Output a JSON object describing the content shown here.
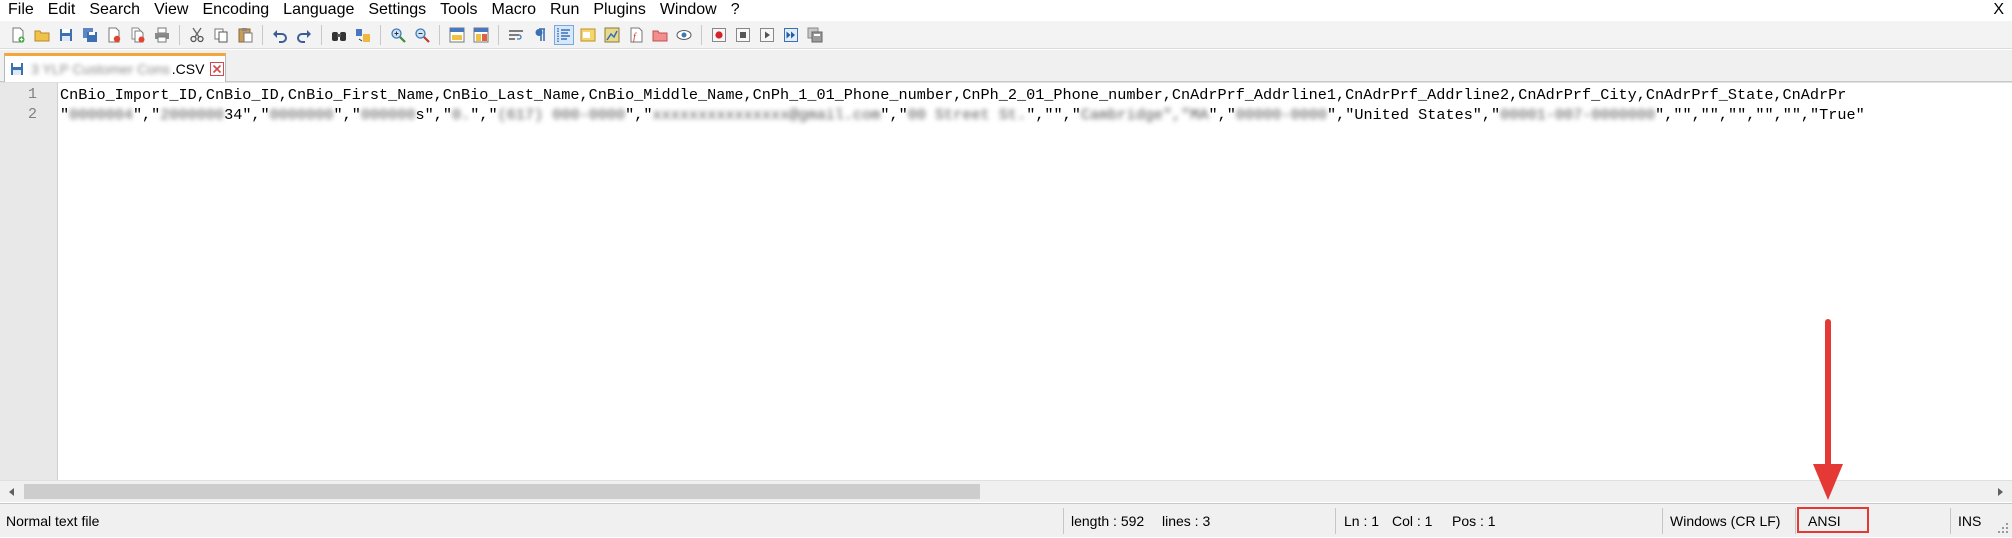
{
  "menu": {
    "items": [
      "File",
      "Edit",
      "Search",
      "View",
      "Encoding",
      "Language",
      "Settings",
      "Tools",
      "Macro",
      "Run",
      "Plugins",
      "Window",
      "?"
    ],
    "close": "X"
  },
  "toolbar": {
    "icons": [
      "new-file-icon",
      "open-file-icon",
      "save-icon",
      "save-all-icon",
      "close-icon",
      "close-all-icon",
      "print-icon",
      "cut-icon",
      "copy-icon",
      "paste-icon",
      "undo-icon",
      "redo-icon",
      "find-icon",
      "replace-icon",
      "zoom-in-icon",
      "zoom-out-icon",
      "sync-vertical-icon",
      "sync-horizontal-icon",
      "word-wrap-icon",
      "show-all-chars-icon",
      "indent-guide-icon",
      "user-defined-language-icon",
      "document-map-icon",
      "function-list-icon",
      "folder-workspace-icon",
      "monitoring-icon",
      "record-macro-icon",
      "stop-macro-icon",
      "play-macro-icon",
      "run-macro-multiple-icon",
      "save-macro-icon"
    ]
  },
  "tab": {
    "name": "3 YLP Customer Cons",
    "ext": ".CSV"
  },
  "editor": {
    "line_numbers": [
      "1",
      "2"
    ],
    "line1": "CnBio_Import_ID,CnBio_ID,CnBio_First_Name,CnBio_Last_Name,CnBio_Middle_Name,CnPh_1_01_Phone_number,CnPh_2_01_Phone_number,CnAdrPrf_Addrline1,CnAdrPrf_Addrline2,CnAdrPrf_City,CnAdrPrf_State,CnAdrPr",
    "line2": [
      {
        "t": "\"",
        "b": false
      },
      {
        "t": "0000004",
        "b": true
      },
      {
        "t": "\",\"",
        "b": false
      },
      {
        "t": "2000000",
        "b": true
      },
      {
        "t": "34\",\"",
        "b": false
      },
      {
        "t": "0000000",
        "b": true
      },
      {
        "t": "\",\"",
        "b": false
      },
      {
        "t": "000000",
        "b": true
      },
      {
        "t": "s\",\"",
        "b": false
      },
      {
        "t": "0.",
        "b": true
      },
      {
        "t": "\",\"",
        "b": false
      },
      {
        "t": "(617) 000-0000",
        "b": true
      },
      {
        "t": "\",\"",
        "b": false
      },
      {
        "t": "xxxxxxxxxxxxxxx@gmail.com",
        "b": true
      },
      {
        "t": "\",\"",
        "b": false
      },
      {
        "t": "00 Street St.",
        "b": true
      },
      {
        "t": "\",\"\",\"",
        "b": false
      },
      {
        "t": "Cambridge\",\"MA",
        "b": true
      },
      {
        "t": "\",\"",
        "b": false
      },
      {
        "t": "00000-0000",
        "b": true
      },
      {
        "t": "\",\"United States\",\"",
        "b": false
      },
      {
        "t": "00001-007-0000000",
        "b": true
      },
      {
        "t": "\",\"\",\"\",\"\",\"\",\"\",\"True\"",
        "b": false
      }
    ]
  },
  "status": {
    "file_type": "Normal text file",
    "length": "length : 592",
    "lines": "lines : 3",
    "ln": "Ln : 1",
    "col": "Col : 1",
    "pos": "Pos : 1",
    "eol": "Windows (CR LF)",
    "encoding": "ANSI",
    "mode": "INS"
  },
  "colors": {
    "annotation": "#e53935",
    "tab_accent": "#f4a53c"
  }
}
